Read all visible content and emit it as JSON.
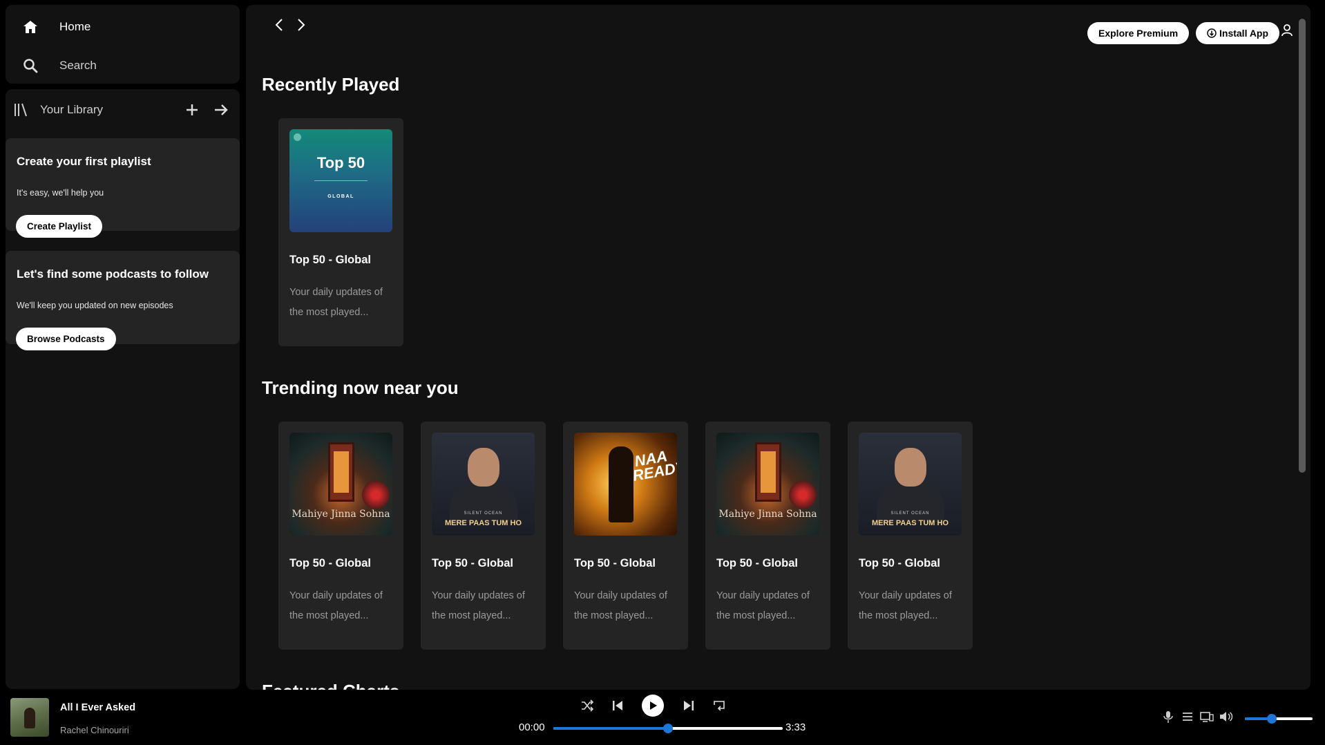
{
  "sidebar": {
    "nav": {
      "home_label": "Home",
      "search_label": "Search"
    },
    "library": {
      "title": "Your Library",
      "promos": [
        {
          "title": "Create your first playlist",
          "subtitle": "It's easy, we'll help you",
          "button": "Create Playlist"
        },
        {
          "title": "Let's find some podcasts to follow",
          "subtitle": "We'll keep you updated on new episodes",
          "button": "Browse Podcasts"
        }
      ]
    }
  },
  "header": {
    "premium_label": "Explore Premium",
    "install_label": "Install App"
  },
  "sections": {
    "recent": {
      "title": "Recently Played",
      "cards": [
        {
          "title": "Top 50 - Global",
          "desc": "Your daily updates of the most played...",
          "cover_title": "Top 50",
          "cover_sub": "GLOBAL"
        }
      ]
    },
    "trending": {
      "title": "Trending now near you",
      "cards": [
        {
          "title": "Top 50 - Global",
          "desc": "Your daily updates of the most played...",
          "cover_text": "Mahiye Jinna Sohna"
        },
        {
          "title": "Top 50 - Global",
          "desc": "Your daily updates of the most played...",
          "cover_text": "MERE PAAS TUM HO",
          "cover_sub": "SILENT OCEAN"
        },
        {
          "title": "Top 50 - Global",
          "desc": "Your daily updates of the most played...",
          "cover_text": "NAA READY"
        },
        {
          "title": "Top 50 - Global",
          "desc": "Your daily updates of the most played...",
          "cover_text": "Mahiye Jinna Sohna"
        },
        {
          "title": "Top 50 - Global",
          "desc": "Your daily updates of the most played...",
          "cover_text": "MERE PAAS TUM HO",
          "cover_sub": "SILENT OCEAN"
        }
      ]
    },
    "featured": {
      "title": "Featured Charts"
    }
  },
  "player": {
    "track_title": "All I Ever Asked",
    "artist": "Rachel Chinouriri",
    "elapsed": "00:00",
    "duration": "3:33",
    "progress_fraction": 0.5,
    "volume_fraction": 0.4
  },
  "colors": {
    "accent": "#1e76d8",
    "panel": "#121212",
    "card": "#242424"
  },
  "icons": [
    "home-icon",
    "search-icon",
    "library-icon",
    "plus-icon",
    "arrow-right-icon",
    "chevron-left-icon",
    "chevron-right-icon",
    "download-icon",
    "user-icon",
    "shuffle-icon",
    "previous-icon",
    "play-icon",
    "next-icon",
    "repeat-icon",
    "mic-icon",
    "queue-icon",
    "device-icon",
    "volume-icon"
  ]
}
